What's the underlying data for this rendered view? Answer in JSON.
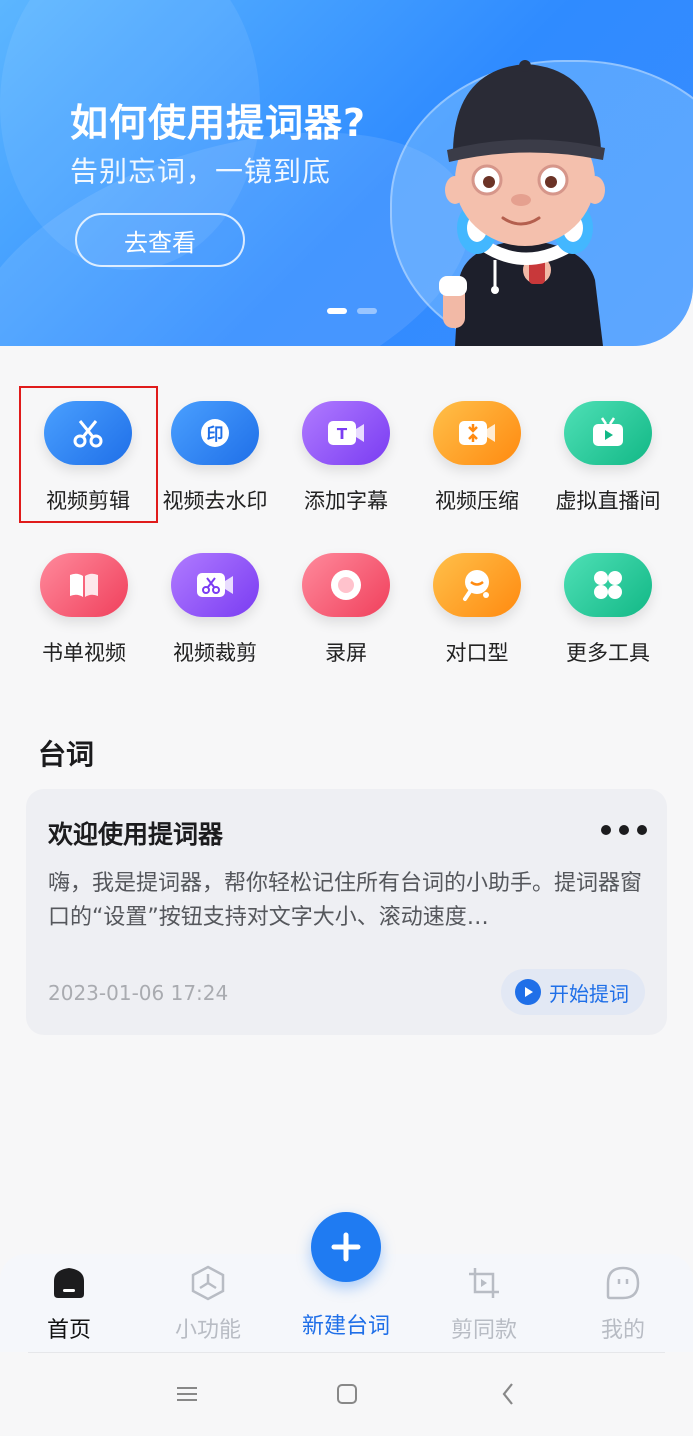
{
  "banner": {
    "title": "如何使用提词器?",
    "subtitle": "告别忘词，一镜到底",
    "button_label": "去查看",
    "slides": 2,
    "active_slide": 1
  },
  "tools": [
    {
      "label": "视频剪辑",
      "icon": "scissors-icon",
      "color": "#2f7df6"
    },
    {
      "label": "视频去水印",
      "icon": "watermark-icon",
      "color": "#2f7df6"
    },
    {
      "label": "添加字幕",
      "icon": "subtitle-icon",
      "color": "#8b4dff"
    },
    {
      "label": "视频压缩",
      "icon": "compress-icon",
      "color": "#ff9a1f"
    },
    {
      "label": "虚拟直播间",
      "icon": "live-tv-icon",
      "color": "#20c99a"
    },
    {
      "label": "书单视频",
      "icon": "book-icon",
      "color": "#ff5a72"
    },
    {
      "label": "视频裁剪",
      "icon": "crop-video-icon",
      "color": "#8b4dff"
    },
    {
      "label": "录屏",
      "icon": "record-icon",
      "color": "#ff5a72"
    },
    {
      "label": "对口型",
      "icon": "lipsync-icon",
      "color": "#ff9a1f"
    },
    {
      "label": "更多工具",
      "icon": "more-tools-icon",
      "color": "#20c99a"
    }
  ],
  "section_title": "台词",
  "script_card": {
    "title": "欢迎使用提词器",
    "body": "嗨，我是提词器，帮你轻松记住所有台词的小助手。提词器窗口的“设置”按钮支持对文字大小、滚动速度…",
    "date": "2023-01-06 17:24",
    "action_label": "开始提词"
  },
  "nav": {
    "items": [
      {
        "label": "首页",
        "icon": "home-icon",
        "state": "active"
      },
      {
        "label": "小功能",
        "icon": "features-icon",
        "state": "inactive"
      },
      {
        "label": "新建台词",
        "icon": "plus-icon",
        "state": "center"
      },
      {
        "label": "剪同款",
        "icon": "crop-template-icon",
        "state": "inactive"
      },
      {
        "label": "我的",
        "icon": "profile-icon",
        "state": "inactive"
      }
    ]
  },
  "colors": {
    "accent": "#1f7bf2",
    "highlight_border": "#e01b1b"
  }
}
